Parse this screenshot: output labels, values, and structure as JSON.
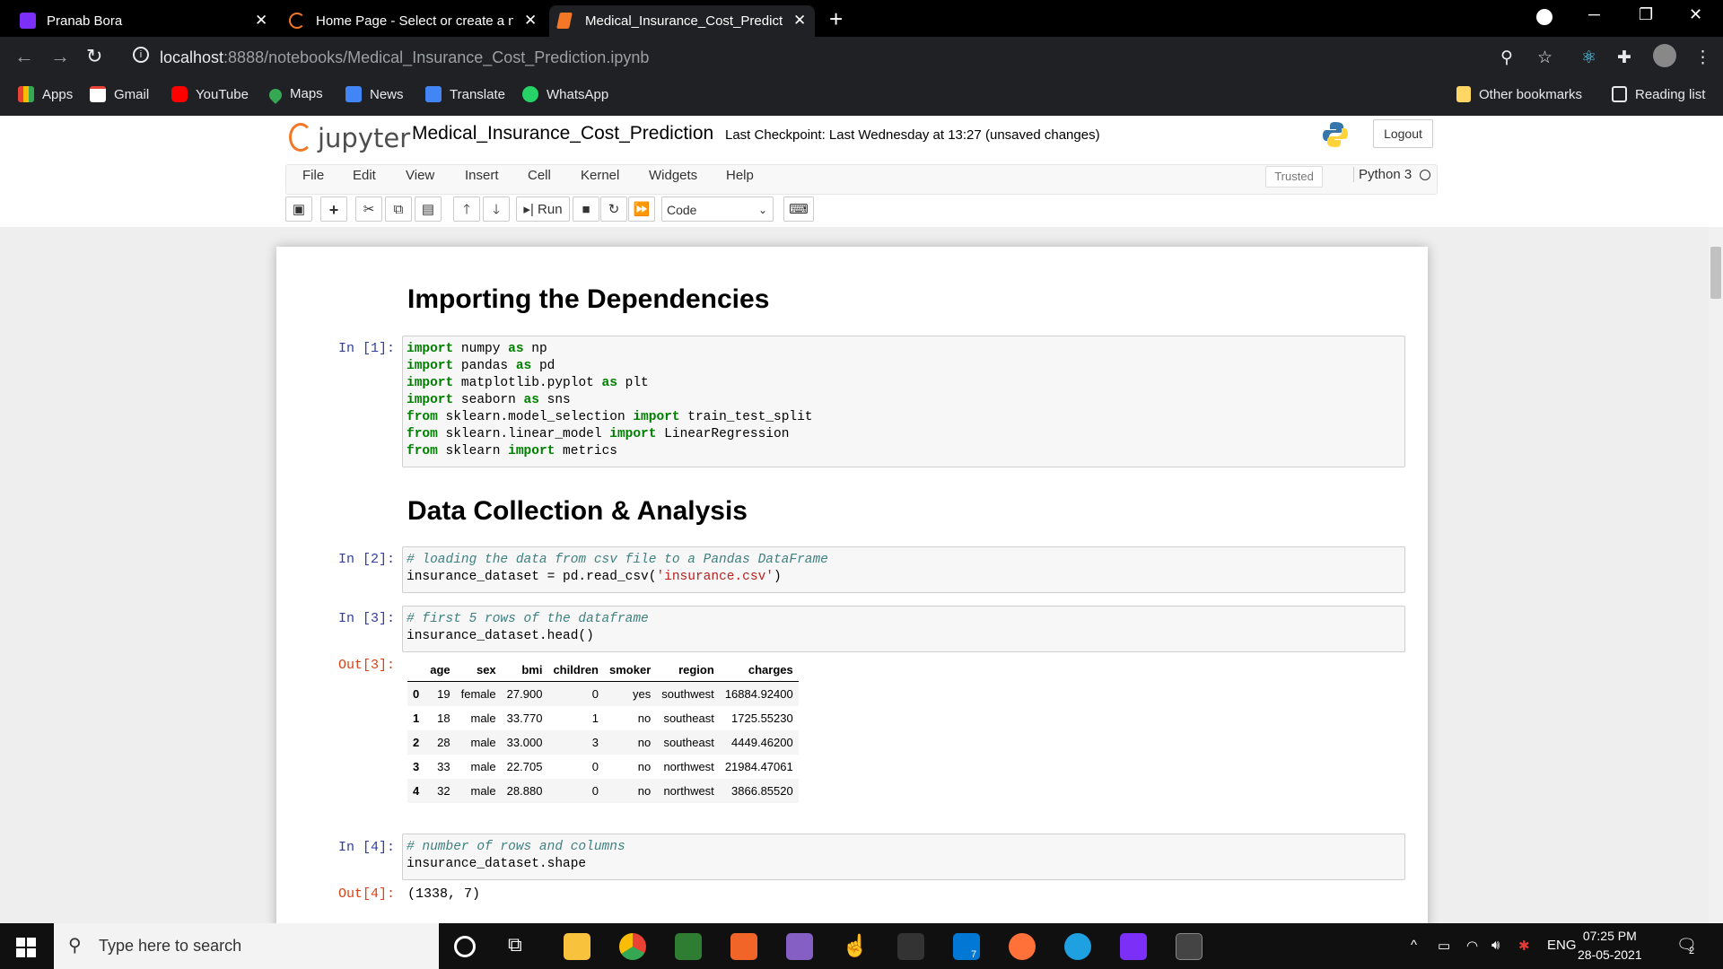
{
  "browser": {
    "tabs": [
      {
        "title": "Pranab Bora",
        "close": "✕"
      },
      {
        "title": "Home Page - Select or create a n",
        "close": "✕"
      },
      {
        "title": "Medical_Insurance_Cost_Predictio",
        "close": "✕"
      }
    ],
    "new_tab": "+",
    "url_host": "localhost",
    "url_rest": ":8888/notebooks/Medical_Insurance_Cost_Prediction.ipynb",
    "bookmarks": [
      "Apps",
      "Gmail",
      "YouTube",
      "Maps",
      "News",
      "Translate",
      "WhatsApp"
    ],
    "other_bookmarks": "Other bookmarks",
    "reading_list": "Reading list"
  },
  "jupyter": {
    "logo_text": "jupyter",
    "notebook_name": "Medical_Insurance_Cost_Prediction",
    "checkpoint": "Last Checkpoint: Last Wednesday at 13:27",
    "unsaved": "(unsaved changes)",
    "logout": "Logout",
    "menu": [
      "File",
      "Edit",
      "View",
      "Insert",
      "Cell",
      "Kernel",
      "Widgets",
      "Help"
    ],
    "trusted": "Trusted",
    "kernel": "Python 3",
    "run_label": "Run",
    "cell_type": "Code"
  },
  "notebook": {
    "heading1": "Importing the Dependencies",
    "heading2": "Data Collection & Analysis",
    "prompt_in1": "In [1]:",
    "prompt_in2": "In [2]:",
    "prompt_in3": "In [3]:",
    "prompt_out3": "Out[3]:",
    "prompt_in4": "In [4]:",
    "prompt_out4": "Out[4]:",
    "out4": "(1338, 7)",
    "table": {
      "columns": [
        "",
        "age",
        "sex",
        "bmi",
        "children",
        "smoker",
        "region",
        "charges"
      ],
      "rows": [
        [
          "0",
          "19",
          "female",
          "27.900",
          "0",
          "yes",
          "southwest",
          "16884.92400"
        ],
        [
          "1",
          "18",
          "male",
          "33.770",
          "1",
          "no",
          "southeast",
          "1725.55230"
        ],
        [
          "2",
          "28",
          "male",
          "33.000",
          "3",
          "no",
          "southeast",
          "4449.46200"
        ],
        [
          "3",
          "33",
          "male",
          "22.705",
          "0",
          "no",
          "northwest",
          "21984.47061"
        ],
        [
          "4",
          "32",
          "male",
          "28.880",
          "0",
          "no",
          "northwest",
          "3866.85520"
        ]
      ]
    }
  },
  "taskbar": {
    "search_placeholder": "Type here to search",
    "lang": "ENG",
    "time": "07:25 PM",
    "date": "28-05-2021",
    "mail_badge": "7",
    "notif_badge": "2"
  }
}
